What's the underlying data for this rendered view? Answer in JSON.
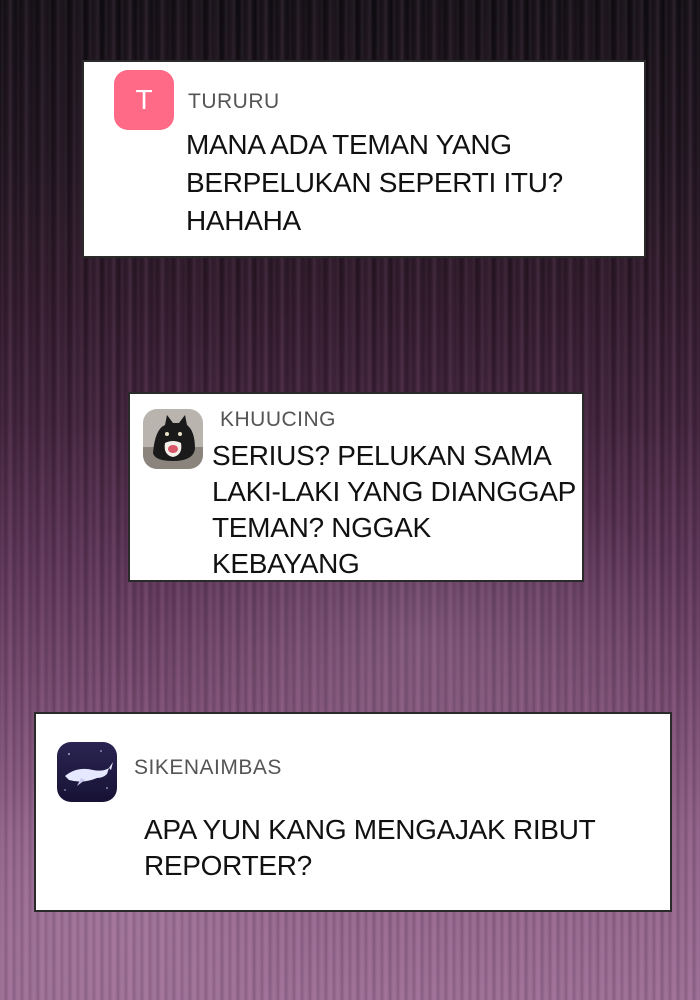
{
  "comments": [
    {
      "avatar_letter": "T",
      "avatar_color": "#ff6b86",
      "username": "TURURU",
      "text": "MANA ADA TEMAN YANG\nBERPELUKAN SEPERTI ITU?\nHAHAHA"
    },
    {
      "avatar_icon": "cat-photo-avatar",
      "username": "KHUUCING",
      "text": "SERIUS? PELUKAN SAMA\nLAKI-LAKI YANG DIANGGAP\nTEMAN? NGGAK KEBAYANG"
    },
    {
      "avatar_icon": "whale-avatar",
      "username": "SIKENAIMBAS",
      "text": "APA YUN KANG MENGAJAK RIBUT\nREPORTER?"
    }
  ]
}
